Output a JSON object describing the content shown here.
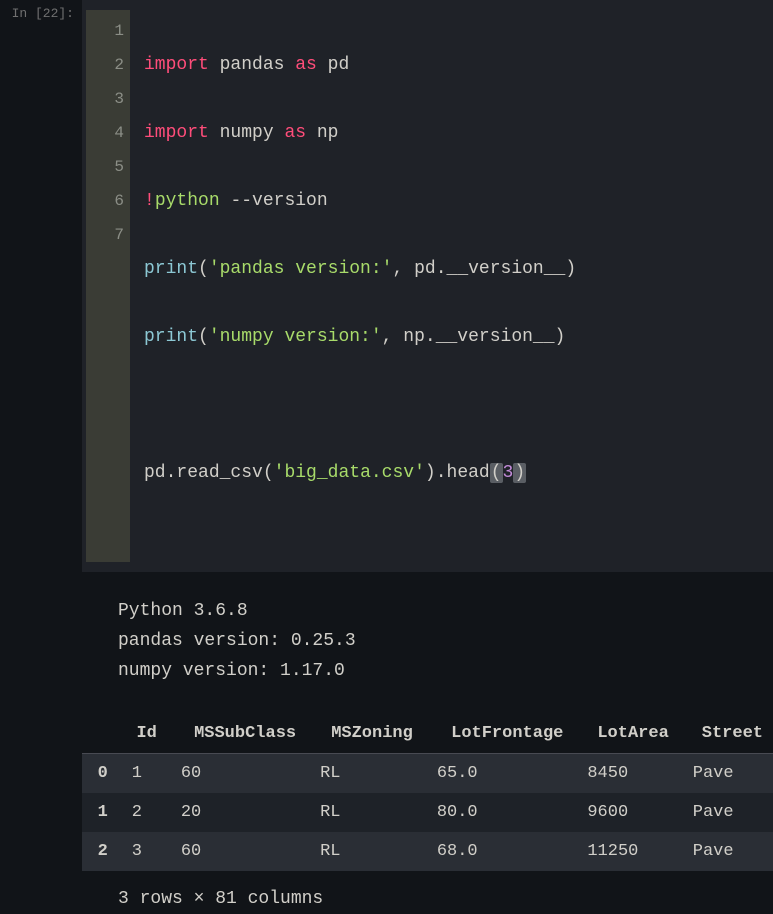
{
  "prompt": "In [22]:",
  "gutter": [
    "1",
    "2",
    "3",
    "4",
    "5",
    "6",
    "7"
  ],
  "code": {
    "l1": {
      "kw": "import",
      "id": "pandas",
      "as": "as",
      "alias": "pd"
    },
    "l2": {
      "kw": "import",
      "id": "numpy",
      "as": "as",
      "alias": "np"
    },
    "l3": {
      "bang": "!",
      "cmd": "python",
      "opt": "--version"
    },
    "l4": {
      "fn": "print",
      "open": "(",
      "str": "'pandas version:'",
      "comma": ",",
      "sp": " ",
      "id1": "pd",
      "dot": ".",
      "dunder": "__version__",
      "close": ")"
    },
    "l5": {
      "fn": "print",
      "open": "(",
      "str": "'numpy version:'",
      "comma": ",",
      "sp": " ",
      "id1": "np",
      "dot": ".",
      "dunder": "__version__",
      "close": ")"
    },
    "l7": {
      "id": "pd",
      "dot1": ".",
      "fn1": "read_csv",
      "open1": "(",
      "str": "'big_data.csv'",
      "close1": ")",
      "dot2": ".",
      "fn2": "head",
      "open2": "(",
      "num": "3",
      "close2": ")"
    }
  },
  "stdout": {
    "line1": "Python 3.6.8",
    "line2": "pandas version: 0.25.3",
    "line3": "numpy version: 1.17.0"
  },
  "df": {
    "columns": [
      "Id",
      "MSSubClass",
      "MSZoning",
      "LotFrontage",
      "LotArea",
      "Street"
    ],
    "index": [
      "0",
      "1",
      "2"
    ],
    "rows": [
      [
        "1",
        "60",
        "RL",
        "65.0",
        "8450",
        "Pave"
      ],
      [
        "2",
        "20",
        "RL",
        "80.0",
        "9600",
        "Pave"
      ],
      [
        "3",
        "60",
        "RL",
        "68.0",
        "11250",
        "Pave"
      ]
    ]
  },
  "df_footer": "3 rows × 81 columns"
}
